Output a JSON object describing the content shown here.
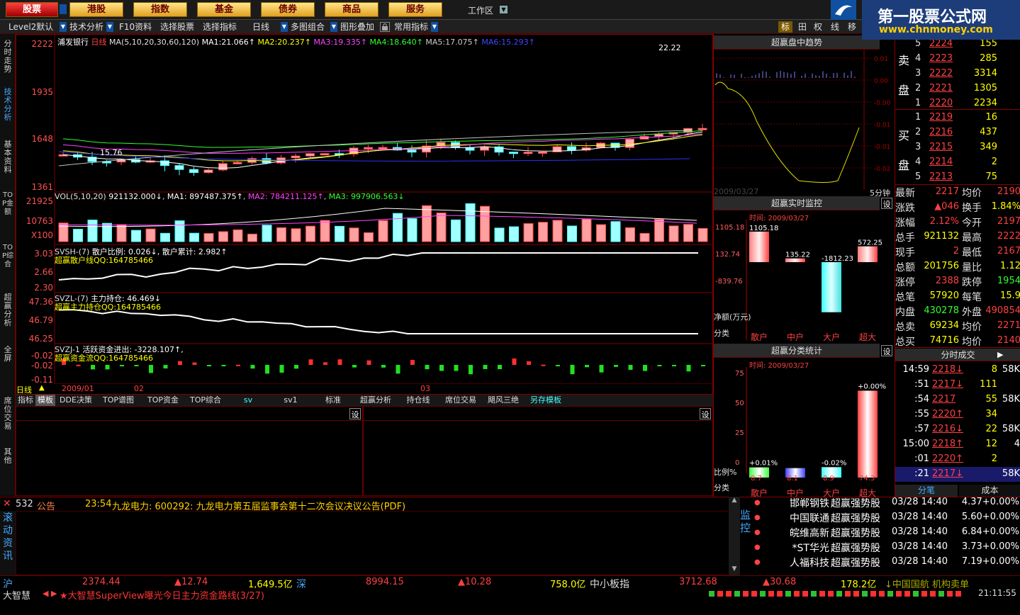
{
  "menu": {
    "items": [
      "股票",
      "港股",
      "指数",
      "基金",
      "债券",
      "商品",
      "服务"
    ],
    "workspace": "工作区"
  },
  "logo": {
    "title": "第一股票公式网",
    "url": "www.chnmoney.com"
  },
  "toolbar": {
    "items": [
      "Level2默认",
      "技术分析",
      "F10资料",
      "选择股票",
      "选择指标",
      "日线",
      "多图组合",
      "图形叠加",
      "常用指标"
    ],
    "right": [
      "标",
      "田",
      "权",
      "线",
      "移"
    ]
  },
  "sidebar": {
    "tabs": [
      "分时走势",
      "技术分析",
      "基本资料",
      "TOP金额",
      "TOP综合",
      "超赢分析",
      "全屏",
      "席位交易",
      "其他"
    ]
  },
  "main_chart": {
    "title": "浦发银行",
    "period": "日线",
    "ma_params": "MA(5,10,20,30,60,120)",
    "ma": [
      {
        "name": "MA1:",
        "value": "21.066↑",
        "color": "#ffffff"
      },
      {
        "name": "MA2:",
        "value": "20.237↑",
        "color": "#ffff00"
      },
      {
        "name": "MA3:",
        "value": "19.335↑",
        "color": "#ff40ff"
      },
      {
        "name": "MA4:",
        "value": "18.640↑",
        "color": "#30ff30"
      },
      {
        "name": "MA5:",
        "value": "17.075↑",
        "color": "#c0c0c0"
      },
      {
        "name": "MA6:",
        "value": "15.293↑",
        "color": "#4040ff"
      }
    ],
    "yticks": [
      "2222",
      "1935",
      "1648",
      "1361"
    ],
    "high_label": "22.22",
    "low_label": "15.76"
  },
  "volume": {
    "label": "VOL(5,10,20)",
    "value": "921132.000↓",
    "ma1": "MA1: 897487.375↑",
    "ma2": "MA2: 784211.125↑",
    "ma3": "MA3: 997906.563↓",
    "yticks": [
      "21925",
      "10763",
      "X100"
    ]
  },
  "svsh": {
    "label": "SVSH-(7)",
    "text1": "散户比例: 0.026↓,",
    "text2": "散户累计: 2.982↑",
    "sub": "超赢散户线QQ:164785466",
    "yticks": [
      "3.03",
      "2.66",
      "2.30"
    ]
  },
  "svzl": {
    "label": "SVZL-(7)",
    "text1": "主力持仓: 46.469↓",
    "sub": "超赢主力持仓QQ:164785466",
    "yticks": [
      "47.36",
      "46.79",
      "46.25"
    ]
  },
  "svzj": {
    "label": "SVZJ-1",
    "text1": "活跃资金进出: -3228.107↑,",
    "sub": "超赢资金流QQ:164785466",
    "yticks": [
      "-0.02",
      "-0.02",
      "-0.11"
    ]
  },
  "date_axis": {
    "period": "日线",
    "d1": "2009/01",
    "d2": "02",
    "d3": "03"
  },
  "tabs": [
    "指标",
    "模板",
    "DDE决策",
    "TOP谱图",
    "TOP资金",
    "TOP综合",
    "sv",
    "sv1",
    "标准",
    "超赢分析",
    "持仓线",
    "席位交易",
    "飓风三绝",
    "另存模板"
  ],
  "set_label": "设",
  "trend": {
    "title": "超赢盘中趋势",
    "date": "2009/03/27",
    "period": "5分钟",
    "ticks": [
      "0.01",
      "0.00",
      "-0.00",
      "-0.01",
      "-0.01",
      "-0.02"
    ]
  },
  "monitor": {
    "title": "超赢实时监控",
    "time": "时间: 2009/03/27",
    "yticks": [
      "1105.18",
      "132.74",
      "-839.76"
    ],
    "net_label": "净额(万元)",
    "class_label": "分类",
    "bars": [
      {
        "cat": "散户",
        "val": "1105.18"
      },
      {
        "cat": "中户",
        "val": "135.22"
      },
      {
        "cat": "大户",
        "val": "-1812.23"
      },
      {
        "cat": "超大",
        "val": "572.25"
      }
    ]
  },
  "stats": {
    "title": "超赢分类统计",
    "time": "时间: 2009/03/27",
    "yticks": [
      "75",
      "50",
      "25",
      "0"
    ],
    "ratio_label": "比例%",
    "class_label": "分类",
    "bars": [
      {
        "cat": "散户",
        "val": "8.7",
        "pct": "+0.01%"
      },
      {
        "cat": "中户",
        "val": "8.1",
        "pct": ""
      },
      {
        "cat": "大户",
        "val": "8.9",
        "pct": "-0.02%"
      },
      {
        "cat": "超大",
        "val": "74.3",
        "pct": "+0.00%"
      }
    ]
  },
  "orderbook": {
    "sell_label": [
      "卖",
      "盘"
    ],
    "buy_label": [
      "买",
      "盘"
    ],
    "sell": [
      {
        "n": "5",
        "p": "2224",
        "v": "155"
      },
      {
        "n": "4",
        "p": "2223",
        "v": "285"
      },
      {
        "n": "3",
        "p": "2222",
        "v": "3314"
      },
      {
        "n": "2",
        "p": "2221",
        "v": "1305"
      },
      {
        "n": "1",
        "p": "2220",
        "v": "2234"
      }
    ],
    "buy": [
      {
        "n": "1",
        "p": "2219",
        "v": "16"
      },
      {
        "n": "2",
        "p": "2216",
        "v": "437"
      },
      {
        "n": "3",
        "p": "2215",
        "v": "349"
      },
      {
        "n": "4",
        "p": "2214",
        "v": "2"
      },
      {
        "n": "5",
        "p": "2213",
        "v": "75"
      }
    ]
  },
  "quote": [
    {
      "k1": "最新",
      "v1": "2217",
      "k2": "均价",
      "v2": "2190",
      "c1": "red",
      "c2": "red"
    },
    {
      "k1": "涨跌",
      "v1": "▲046",
      "k2": "换手",
      "v2": "1.84%",
      "c1": "red",
      "c2": "yel"
    },
    {
      "k1": "涨幅",
      "v1": "2.12%",
      "k2": "今开",
      "v2": "2197",
      "c1": "red",
      "c2": "red"
    },
    {
      "k1": "总手",
      "v1": "921132",
      "k2": "最高",
      "v2": "2222",
      "c1": "yel",
      "c2": "red"
    },
    {
      "k1": "现手",
      "v1": "2",
      "k2": "最低",
      "v2": "2167",
      "c1": "red",
      "c2": "red"
    },
    {
      "k1": "总额",
      "v1": "201756",
      "k2": "量比",
      "v2": "1.12",
      "c1": "yel",
      "c2": "yel"
    },
    {
      "k1": "涨停",
      "v1": "2388",
      "k2": "跌停",
      "v2": "1954",
      "c1": "red",
      "c2": "grn"
    },
    {
      "k1": "总笔",
      "v1": "57920",
      "k2": "每笔",
      "v2": "15.9",
      "c1": "yel",
      "c2": "yel"
    },
    {
      "k1": "内盘",
      "v1": "430278",
      "k2": "外盘",
      "v2": "490854",
      "c1": "grn",
      "c2": "red"
    },
    {
      "k1": "总卖",
      "v1": "69234",
      "k2": "均价",
      "v2": "2271",
      "c1": "yel",
      "c2": "red"
    },
    {
      "k1": "总买",
      "v1": "74716",
      "k2": "均价",
      "v2": "2140",
      "c1": "yel",
      "c2": "red"
    }
  ],
  "ticks": {
    "title": "分时成交",
    "rows": [
      {
        "t": "14:59",
        "p": "2218↓",
        "v": "8",
        "s": "58K",
        "c": "red"
      },
      {
        "t": ":51",
        "p": "2217↓",
        "v": "111",
        "s": "",
        "c": "red"
      },
      {
        "t": ":54",
        "p": "2217",
        "v": "55",
        "s": "58K",
        "c": "red"
      },
      {
        "t": ":55",
        "p": "2220↑",
        "v": "34",
        "s": "",
        "c": "red"
      },
      {
        "t": ":57",
        "p": "2216↓",
        "v": "22",
        "s": "58K",
        "c": "red"
      },
      {
        "t": "15:00",
        "p": "2218↑",
        "v": "12",
        "s": "4",
        "c": "red"
      },
      {
        "t": ":01",
        "p": "2220↑",
        "v": "2",
        "s": "",
        "c": "red"
      },
      {
        "t": ":21",
        "p": "2217↓",
        "v": "",
        "s": "58K",
        "c": "red"
      }
    ],
    "tab1": "分笔",
    "tab2": "成本"
  },
  "news": {
    "count": "532",
    "label": "公告",
    "time": "23:54",
    "headline": "九龙电力: 600292: 九龙电力第五届监事会第十二次会议决议公告(PDF)",
    "side": [
      "滚",
      "动",
      "资",
      "讯"
    ]
  },
  "watch": {
    "side": [
      "监",
      "控"
    ],
    "rows": [
      {
        "name": "邯郸钢铁",
        "type": "超赢强势股",
        "time": "03/28 14:40",
        "pct": "4.37+0.00%"
      },
      {
        "name": "中国联通",
        "type": "超赢强势股",
        "time": "03/28 14:40",
        "pct": "5.60+0.00%"
      },
      {
        "name": "皖维高新",
        "type": "超赢强势股",
        "time": "03/28 14:40",
        "pct": "6.84+0.00%"
      },
      {
        "name": "*ST华光",
        "type": "超赢强势股",
        "time": "03/28 14:40",
        "pct": "3.73+0.00%"
      },
      {
        "name": "人福科技",
        "type": "超赢强势股",
        "time": "03/28 14:40",
        "pct": "7.19+0.00%"
      }
    ]
  },
  "status": {
    "sh": "沪",
    "sh_val": "2374.44",
    "sh_chg": "▲12.74",
    "sh_amt": "1,649.5亿",
    "sz": "深",
    "sz_val": "8994.15",
    "sz_chg": "▲10.28",
    "sz_amt": "758.0亿",
    "zx": "中小板指",
    "zx_val": "3712.68",
    "zx_chg": "▲30.68",
    "zx_amt": "178.2亿",
    "ticker": "↓中国国航 机构卖单"
  },
  "bottom": {
    "brand": "大智慧",
    "scroll": "★大智慧SuperView曝光今日主力资金路线(3/27)",
    "clock": "21:11:55"
  }
}
